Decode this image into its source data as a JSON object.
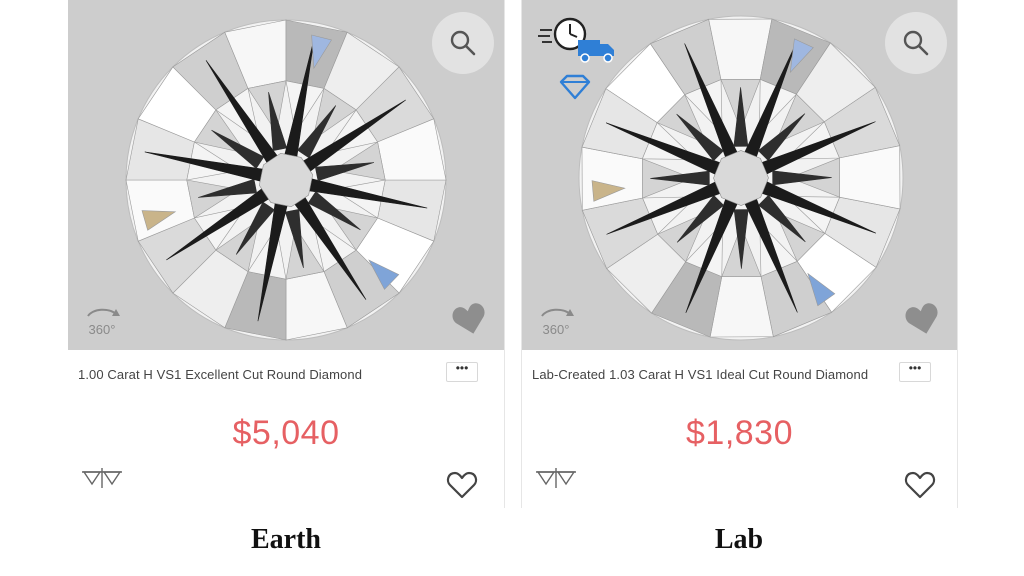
{
  "products": [
    {
      "title": "1.00 Carat H VS1 Excellent Cut Round Diamond",
      "price": "$5,040",
      "more_label": "•••",
      "badge_360": "360°",
      "caption": "Earth",
      "icons": [
        "search-icon",
        "rotate-360-icon",
        "heart-silhouette-icon",
        "compare-icon",
        "heart-outline-icon"
      ]
    },
    {
      "title": "Lab-Created 1.03 Carat H VS1 Ideal Cut Round Diamond",
      "price": "$1,830",
      "more_label": "•••",
      "badge_360": "360°",
      "caption": "Lab",
      "icons": [
        "fast-shipping-icon",
        "blue-diamond-icon",
        "search-icon",
        "rotate-360-icon",
        "heart-silhouette-icon",
        "compare-icon",
        "heart-outline-icon"
      ]
    }
  ],
  "colors": {
    "price": "#e66063",
    "image_background": "#cdcdcd",
    "accent_blue": "#2f7fd6",
    "caption_text": "#111111"
  }
}
